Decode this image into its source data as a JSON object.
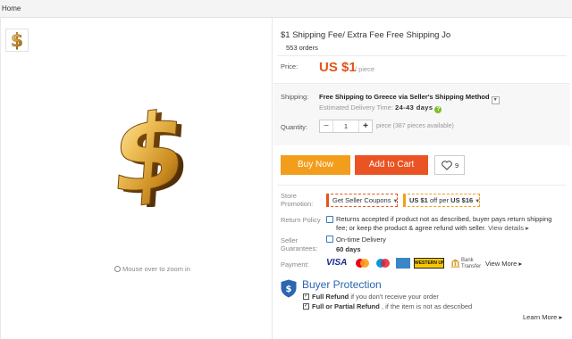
{
  "breadcrumb": "Home",
  "gallery": {
    "zoom_hint": "Mouse over to zoom in",
    "zoom_icon": "search-icon"
  },
  "product": {
    "title": "$1 Shipping Fee/ Extra Fee Free Shipping Jo",
    "orders": "553 orders",
    "price_label": "Price:",
    "price": "US $1",
    "price_unit": "/ piece",
    "shipping_label": "Shipping:",
    "shipping_method": "Free Shipping to Greece via Seller's Shipping Method",
    "estimate_label": "Estimated Delivery Time:",
    "estimate_days": "24-43 days",
    "quantity_label": "Quantity:",
    "quantity_value": "1",
    "availability": "piece (387 pieces available)"
  },
  "actions": {
    "buy_now": "Buy Now",
    "add_to_cart": "Add to Cart",
    "wishlist_count": "9"
  },
  "promotion": {
    "label_line1": "Store",
    "label_line2": "Promotion:",
    "seller_coupons": "Get Seller Coupons",
    "discount_prefix": "US $1",
    "discount_mid": " off per ",
    "discount_suffix": "US $16"
  },
  "return_policy": {
    "label": "Return Policy",
    "text": "Returns accepted if product not as described, buyer pays return shipping fee; or keep the product & agree refund with seller.",
    "link": "View details"
  },
  "guarantees": {
    "label_line1": "Seller",
    "label_line2": "Guarantees:",
    "line1": "On-time Delivery",
    "line2": "60 days"
  },
  "payment": {
    "label": "Payment:",
    "visa": "VISA",
    "western_union": "WESTERN UNION",
    "bank_line1": "Bank",
    "bank_line2": "Transfer",
    "view_more": "View More"
  },
  "protection": {
    "title": "Buyer Protection",
    "item1_bold": "Full Refund",
    "item1_rest": " if you don't receive your order",
    "item2_bold": "Full or Partial Refund",
    "item2_rest": " , if the item is not as described",
    "learn_more": "Learn More"
  },
  "colors": {
    "accent": "#e5541b",
    "buy_now": "#f39d1c",
    "add_to_cart": "#ea5323",
    "protection_blue": "#2b66b0"
  }
}
